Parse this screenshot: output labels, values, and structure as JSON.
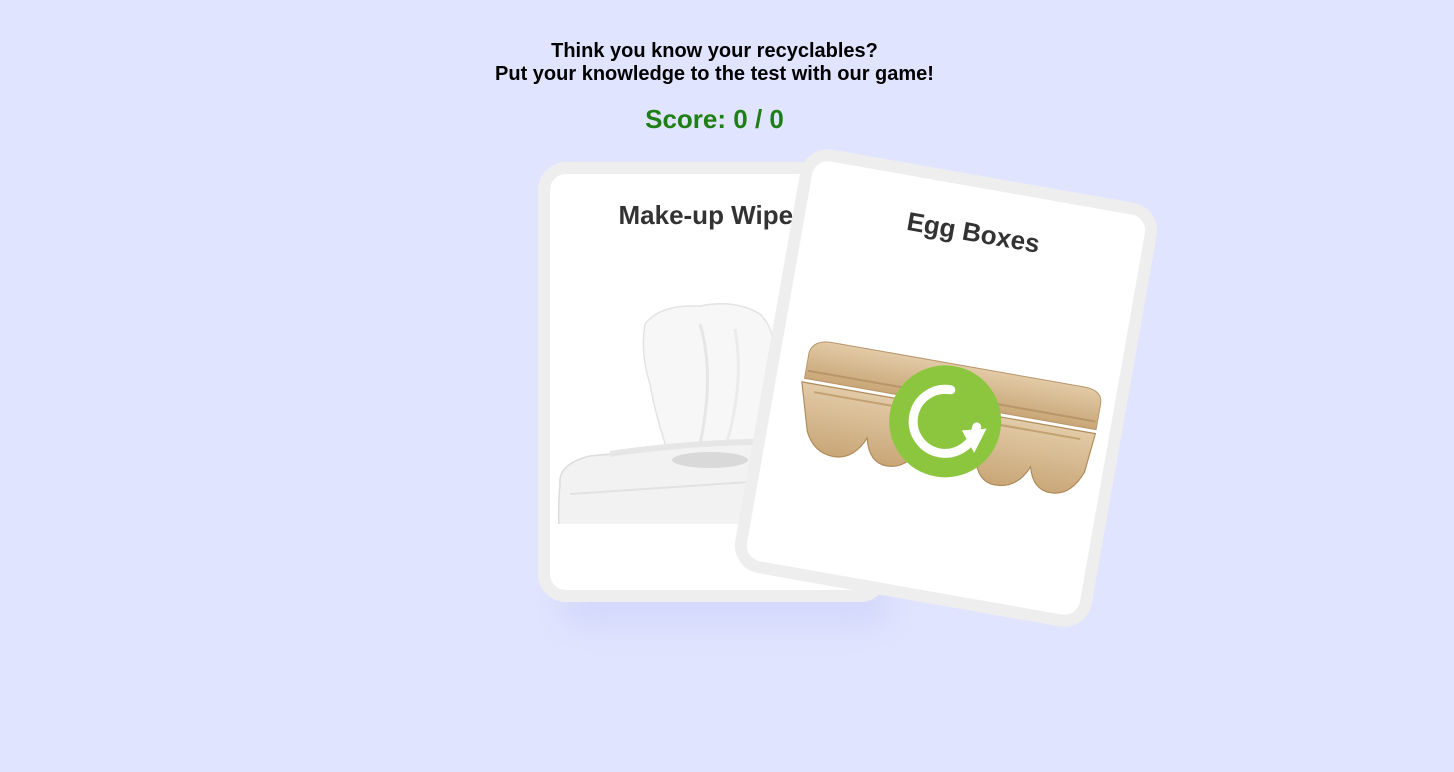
{
  "header": {
    "line1": "Think you know your recyclables?",
    "line2": "Put your knowledge to the test with our game!"
  },
  "score": {
    "label": "Score: 0 / 0"
  },
  "cards": {
    "back": {
      "title": "Make-up Wipes",
      "image": "wipes-pack"
    },
    "front": {
      "title": "Egg Boxes",
      "image": "egg-box",
      "badge": "recycle-icon"
    }
  },
  "colors": {
    "background": "#e0e4fe",
    "score": "#1f7f16",
    "badge": "#8cc63f",
    "card_border": "#eeeeee"
  }
}
